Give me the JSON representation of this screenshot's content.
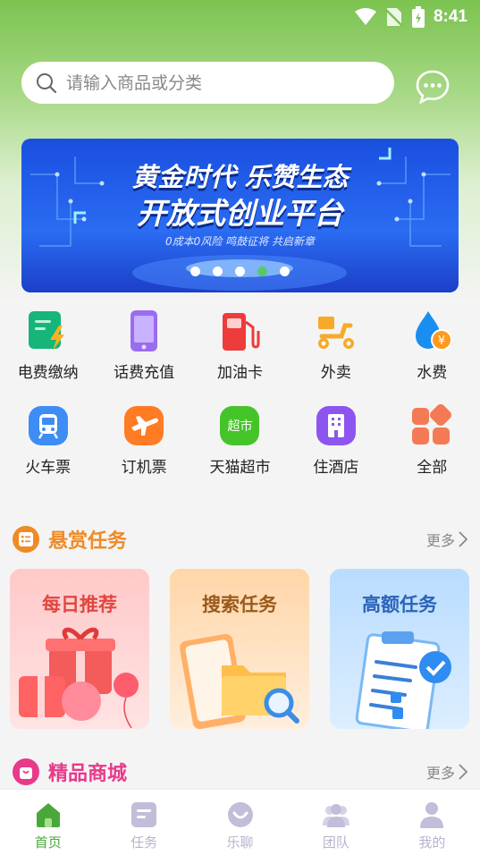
{
  "status_bar": {
    "time": "8:41"
  },
  "search": {
    "placeholder": "请输入商品或分类"
  },
  "banner": {
    "line1": "黄金时代 乐赞生态",
    "line2": "开放式创业平台",
    "subtitle": "0成本0风险 鸣鼓征将 共启新章",
    "dots": 5,
    "active_dot": 4
  },
  "services": [
    {
      "label": "电费缴纳",
      "icon": "electricity-icon"
    },
    {
      "label": "话费充值",
      "icon": "phone-icon"
    },
    {
      "label": "加油卡",
      "icon": "fuel-icon"
    },
    {
      "label": "外卖",
      "icon": "scooter-icon"
    },
    {
      "label": "水费",
      "icon": "water-drop-icon"
    },
    {
      "label": "火车票",
      "icon": "train-icon"
    },
    {
      "label": "订机票",
      "icon": "airplane-icon"
    },
    {
      "label": "天猫超市",
      "icon": "supermarket-icon",
      "badge_text": "超市"
    },
    {
      "label": "住酒店",
      "icon": "hotel-icon"
    },
    {
      "label": "全部",
      "icon": "all-grid-icon"
    }
  ],
  "reward_section": {
    "title": "悬赏任务",
    "more": "更多"
  },
  "task_cards": [
    {
      "title": "每日推荐"
    },
    {
      "title": "搜索任务"
    },
    {
      "title": "高额任务"
    }
  ],
  "mall_section": {
    "title": "精品商城",
    "more": "更多"
  },
  "bottom_nav": [
    {
      "label": "首页",
      "icon": "home-icon",
      "active": true
    },
    {
      "label": "任务",
      "icon": "task-icon",
      "active": false
    },
    {
      "label": "乐聊",
      "icon": "chat-smile-icon",
      "active": false
    },
    {
      "label": "团队",
      "icon": "team-icon",
      "active": false
    },
    {
      "label": "我的",
      "icon": "profile-icon",
      "active": false
    }
  ],
  "colors": {
    "header_green": "#7cc350",
    "accent_orange": "#f08a24",
    "accent_pink": "#e83a8a",
    "nav_active": "#4aa83a",
    "nav_inactive": "#b7b3cc"
  }
}
